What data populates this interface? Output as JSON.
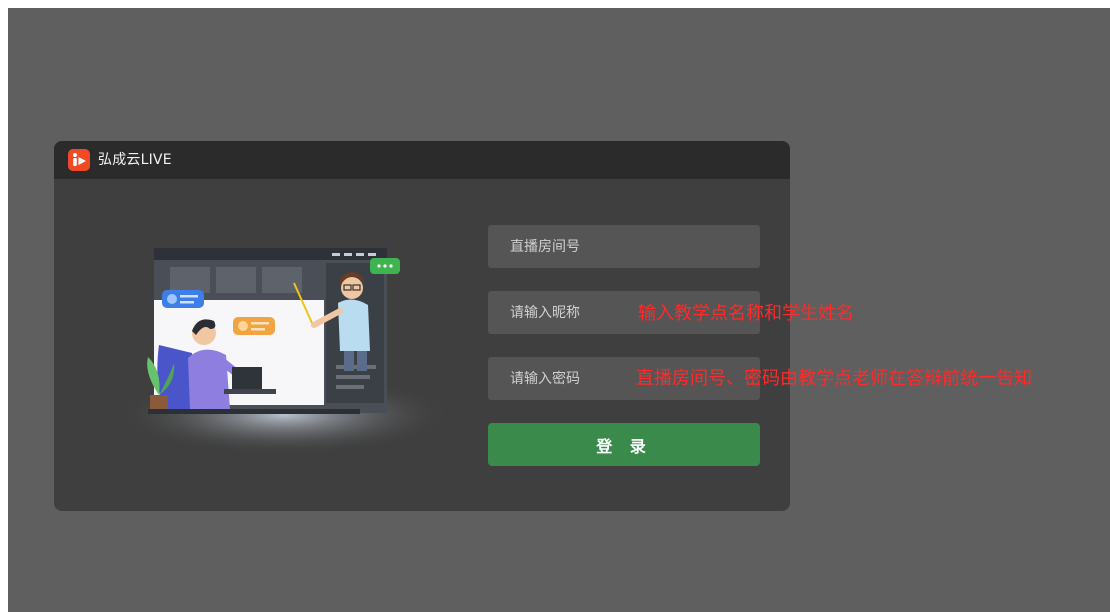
{
  "window": {
    "app_title": "弘成云LIVE",
    "logo_icon": "play-logo-icon",
    "brand_color": "#ef4a23"
  },
  "form": {
    "room_placeholder": "直播房间号",
    "nickname_placeholder": "请输入昵称",
    "password_placeholder": "请输入密码",
    "login_label": "登 录",
    "login_color": "#3a8a4c"
  },
  "annotations": {
    "nickname_note": "输入教学点名称和学生姓名",
    "credentials_note": "直播房间号、密码由教学点老师在答辩前统一告知",
    "note_color": "#ff2a2a"
  }
}
